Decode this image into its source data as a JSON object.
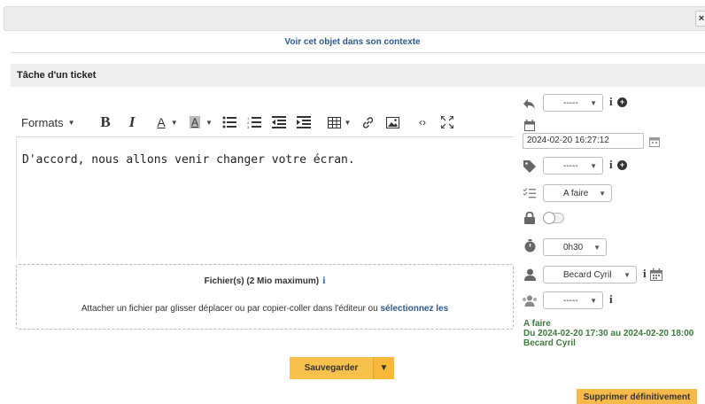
{
  "window": {
    "close_label": "×"
  },
  "context_link": "Voir cet objet dans son contexte",
  "section_title": "Tâche d'un ticket",
  "toolbar": {
    "formats_label": "Formats",
    "bold_label": "B",
    "italic_label": "I",
    "font_color_label": "A",
    "bg_color_label": "A"
  },
  "editor": {
    "content": "D'accord, nous allons venir changer votre écran."
  },
  "dropzone": {
    "title": "Fichier(s) (2 Mio maximum)",
    "info_label": "i",
    "text": "Attacher un fichier par glisser déplacer ou par copier-coller dans l'éditeur ou ",
    "select_link": "sélectionnez les"
  },
  "buttons": {
    "save_label": "Sauvegarder",
    "save_toggle": "▼",
    "delete_label": "Supprimer définitivement"
  },
  "side": {
    "template_value": "-----",
    "date_value": "2024-02-20 16:27:12",
    "category_value": "-----",
    "status_value": "A faire",
    "duration_value": "0h30",
    "user_value": "Becard Cyril",
    "group_value": "-----"
  },
  "summary": {
    "status": "A faire",
    "period": "Du 2024-02-20 17:30 au 2024-02-20 18:00",
    "user": "Becard Cyril"
  },
  "colors": {
    "accent": "#f8c14b",
    "link": "#2d5a8c",
    "summary": "#3f7a3f"
  }
}
